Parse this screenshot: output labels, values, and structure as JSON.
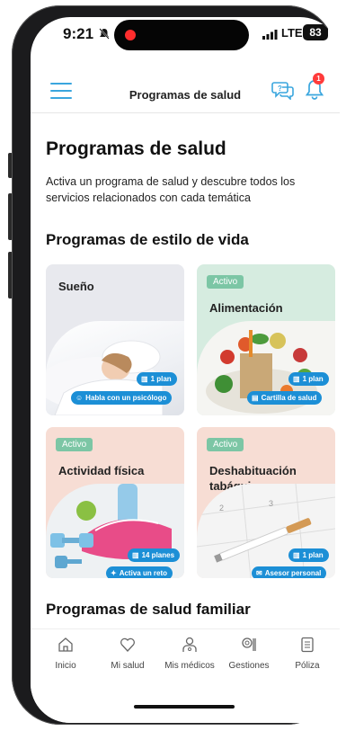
{
  "status": {
    "time": "9:21",
    "network": "LTE",
    "battery": "83"
  },
  "header": {
    "title": "Programas de salud",
    "notification_count": "1"
  },
  "page": {
    "title": "Programas de salud",
    "intro": "Activa un programa de salud y descubre todos los servicios relacionados con cada temática"
  },
  "sections": {
    "lifestyle_title": "Programas de estilo de vida",
    "family_title": "Programas de salud familiar"
  },
  "cards": [
    {
      "title": "Sueño",
      "active": "",
      "pill1": "1 plan",
      "pill2": "Habla con un psicólogo",
      "color": "#e8e9ee"
    },
    {
      "title": "Alimentación",
      "active": "Activo",
      "pill1": "1 plan",
      "pill2": "Cartilla de salud",
      "color": "#d6ece0"
    },
    {
      "title": "Actividad física",
      "active": "Activo",
      "pill1": "14 planes",
      "pill2": "Activa un reto",
      "color": "#f7ddd4"
    },
    {
      "title": "Deshabituación tabáquica",
      "active": "Activo",
      "pill1": "1 plan",
      "pill2": "Asesor personal",
      "color": "#f7ddd4"
    }
  ],
  "nav": [
    {
      "label": "Inicio",
      "icon": "home-icon"
    },
    {
      "label": "Mi salud",
      "icon": "heart-icon"
    },
    {
      "label": "Mis médicos",
      "icon": "doctor-icon"
    },
    {
      "label": "Gestiones",
      "icon": "manage-icon"
    },
    {
      "label": "Póliza",
      "icon": "document-icon"
    }
  ],
  "colors": {
    "accent": "#1c8fd6",
    "active_badge": "#7cc6a5",
    "notification": "#ff3b3b"
  }
}
